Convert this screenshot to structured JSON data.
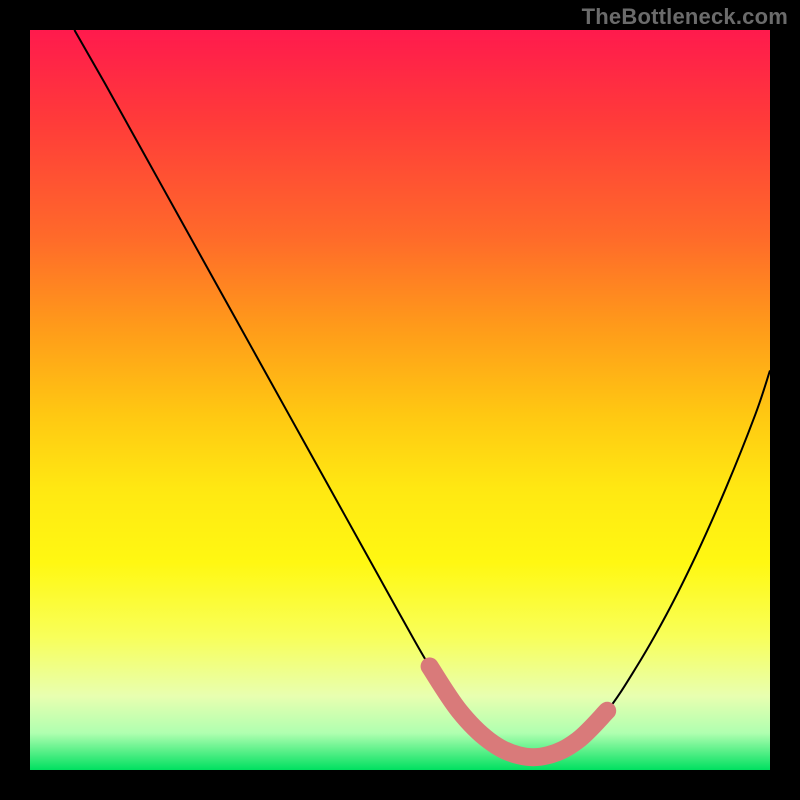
{
  "watermark": "TheBottleneck.com",
  "chart_data": {
    "type": "line",
    "title": "",
    "xlabel": "",
    "ylabel": "",
    "xlim": [
      0,
      100
    ],
    "ylim": [
      0,
      100
    ],
    "series": [
      {
        "name": "bottleneck-curve",
        "x": [
          6,
          10,
          15,
          20,
          25,
          30,
          35,
          40,
          45,
          50,
          54,
          58,
          62,
          66,
          70,
          74,
          78,
          82,
          86,
          90,
          94,
          98,
          100
        ],
        "y": [
          100,
          93,
          84,
          75,
          66,
          57,
          48,
          39,
          30,
          21,
          14,
          8,
          4,
          2,
          2,
          4,
          8,
          14,
          21,
          29,
          38,
          48,
          54
        ]
      },
      {
        "name": "optimal-range-highlight",
        "x": [
          54,
          58,
          62,
          66,
          70,
          74,
          78
        ],
        "y": [
          14,
          8,
          4,
          2,
          2,
          4,
          8
        ]
      }
    ]
  }
}
